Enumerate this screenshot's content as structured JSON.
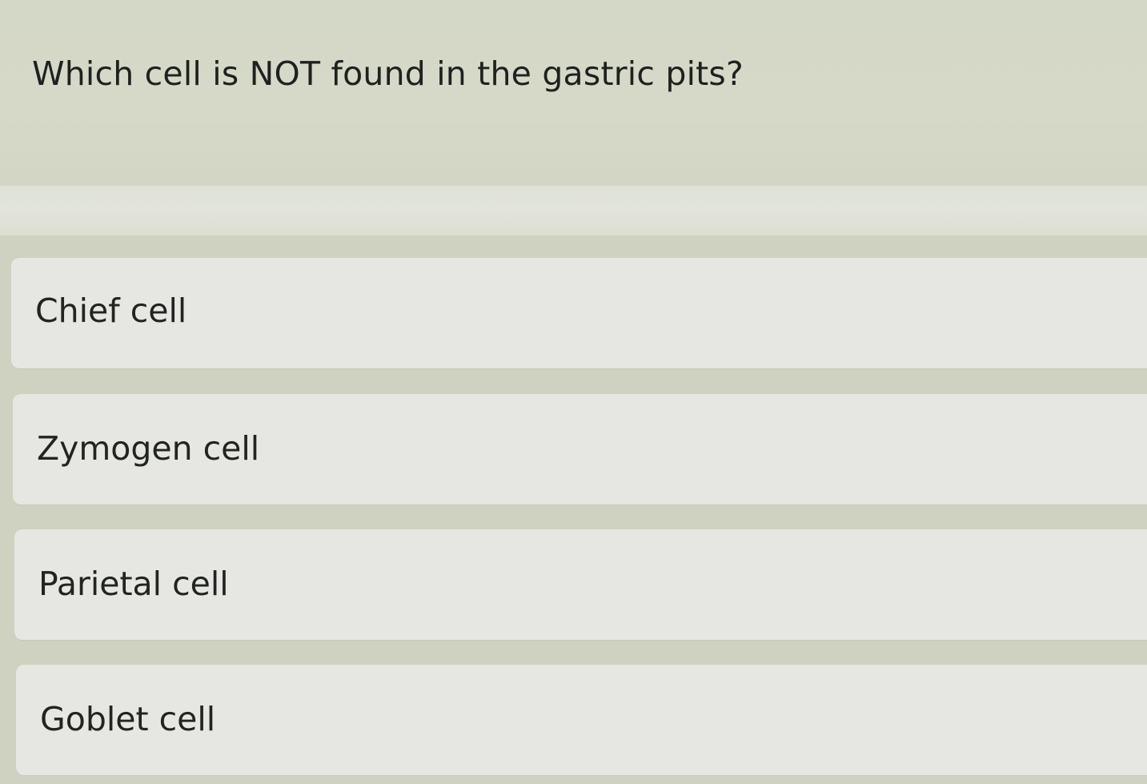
{
  "question": {
    "text": "Which cell is NOT found in the gastric pits?"
  },
  "options": [
    {
      "label": "Chief cell"
    },
    {
      "label": "Zymogen cell"
    },
    {
      "label": "Parietal cell"
    },
    {
      "label": "Goblet cell"
    }
  ],
  "colors": {
    "background": "#d3d6c6",
    "option_card": "#e6e7e3",
    "text": "#222422"
  }
}
